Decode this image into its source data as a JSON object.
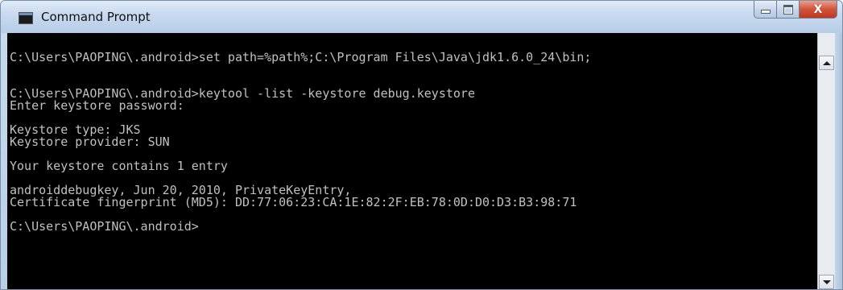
{
  "window": {
    "title": "Command Prompt",
    "icon": "cmd-icon",
    "icon_text": "C:\\",
    "close_glyph": "X"
  },
  "console": {
    "lines": [
      "",
      "C:\\Users\\PAOPING\\.android>set path=%path%;C:\\Program Files\\Java\\jdk1.6.0_24\\bin;",
      "",
      "",
      "C:\\Users\\PAOPING\\.android>keytool -list -keystore debug.keystore",
      "Enter keystore password:",
      "",
      "Keystore type: JKS",
      "Keystore provider: SUN",
      "",
      "Your keystore contains 1 entry",
      "",
      "androiddebugkey, Jun 20, 2010, PrivateKeyEntry,",
      "Certificate fingerprint (MD5): DD:77:06:23:CA:1E:82:2F:EB:78:0D:D0:D3:B3:98:71",
      "",
      "C:\\Users\\PAOPING\\.android>"
    ]
  },
  "colors": {
    "console_bg": "#000000",
    "console_fg": "#c0c0c0",
    "titlebar": "#c7d9ee",
    "close_button": "#c7402a"
  }
}
